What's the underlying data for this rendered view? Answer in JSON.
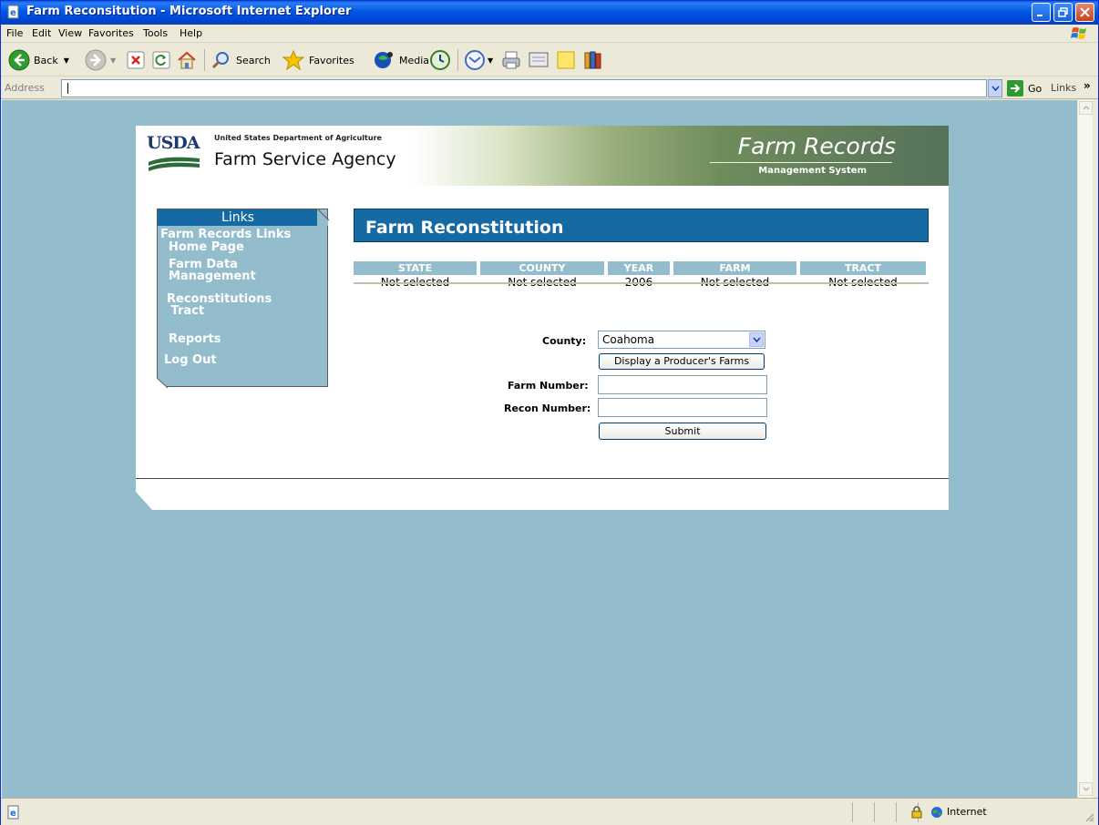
{
  "window": {
    "title": "Farm Reconsitution - Microsoft Internet Explorer"
  },
  "menu": {
    "items": [
      "File",
      "Edit",
      "View",
      "Favorites",
      "Tools",
      "Help"
    ]
  },
  "toolbar": {
    "back_label": "Back",
    "search_label": "Search",
    "favorites_label": "Favorites",
    "media_label": "Media"
  },
  "address_bar": {
    "label": "Address",
    "value": "",
    "go_label": "Go",
    "links_label": "Links"
  },
  "banner": {
    "logo_text": "USDA",
    "department": "United States Department of Agriculture",
    "agency": "Farm Service Agency",
    "system_title": "Farm Records",
    "system_subtitle": "Management System"
  },
  "sidebar": {
    "header": "Links",
    "section": "Farm Records Links",
    "items": [
      {
        "label": "Home Page"
      },
      {
        "label": "Farm Data\nManagement"
      },
      {
        "label": "Reconstitutions\n Tract"
      },
      {
        "label": "Reports"
      },
      {
        "label": "Log Out"
      }
    ]
  },
  "page": {
    "title": "Farm Reconstitution"
  },
  "selection": {
    "headers": [
      "STATE",
      "COUNTY",
      "YEAR",
      "FARM",
      "TRACT"
    ],
    "values": [
      "Not selected",
      "Not selected",
      "2006",
      "Not selected",
      "Not selected"
    ]
  },
  "form": {
    "county_label": "County:",
    "county_value": "Coahoma",
    "display_farms_button": "Display a Producer's Farms",
    "farm_number_label": "Farm Number:",
    "farm_number_value": "",
    "recon_number_label": "Recon Number:",
    "recon_number_value": "",
    "submit_button": "Submit"
  },
  "status_bar": {
    "zone": "Internet"
  },
  "colors": {
    "page_background": "#93bccd",
    "title_blue": "#156aa4",
    "header_cell": "#93bccd"
  }
}
